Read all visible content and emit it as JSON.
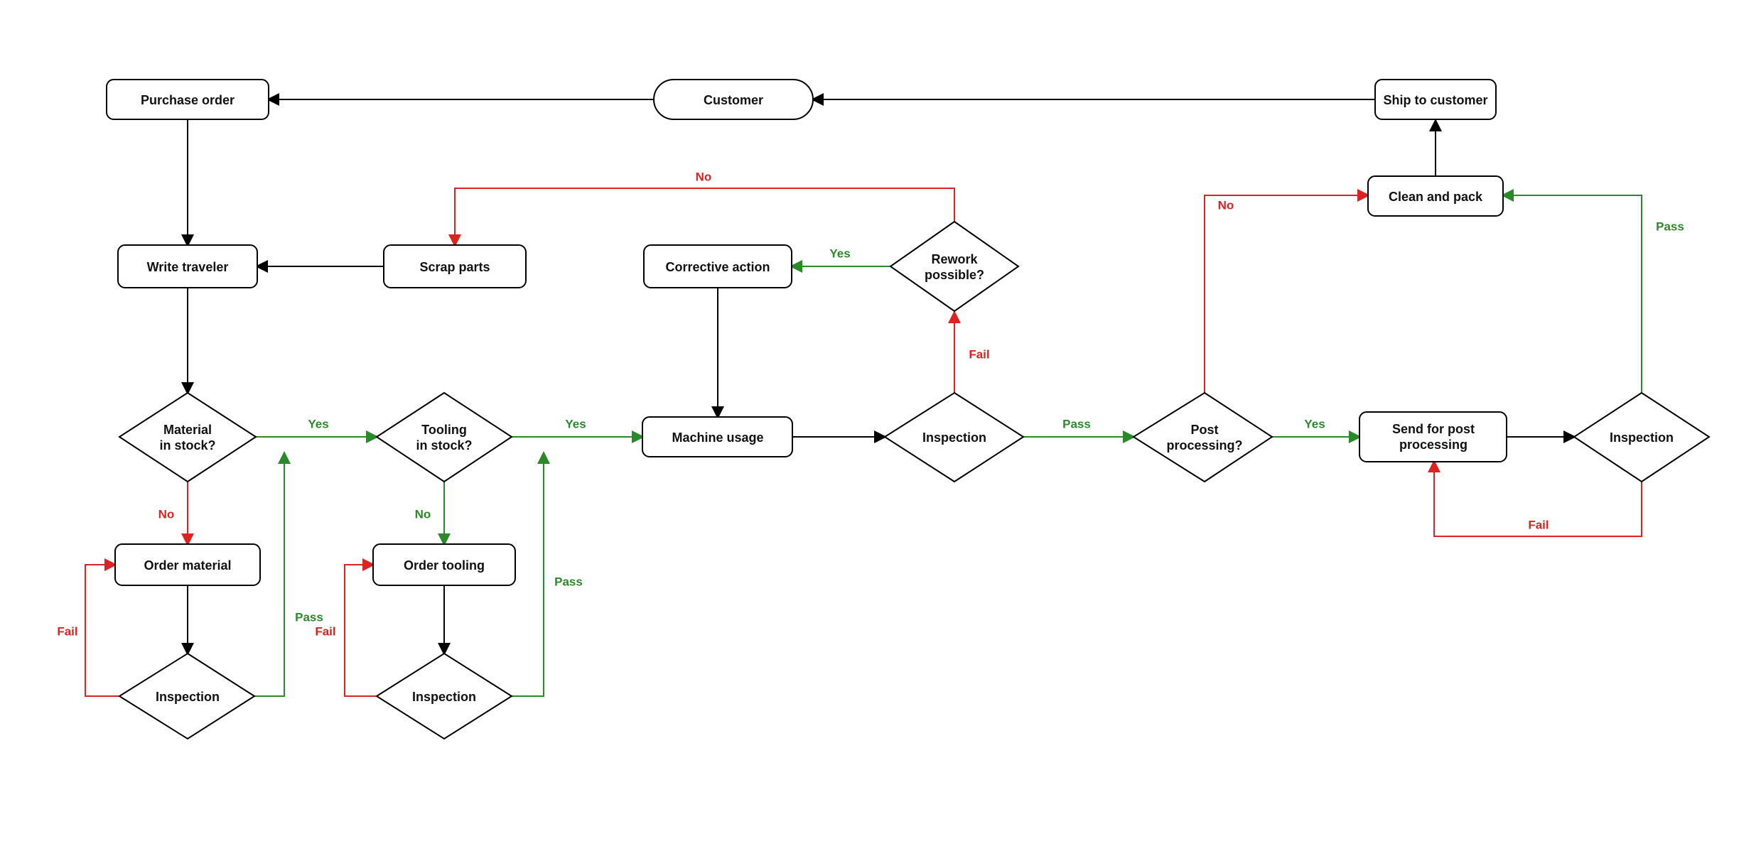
{
  "nodes": {
    "purchase_order": {
      "label": "Purchase order"
    },
    "customer": {
      "label": "Customer"
    },
    "ship_to_customer": {
      "label": "Ship to customer"
    },
    "write_traveler": {
      "label": "Write traveler"
    },
    "scrap_parts": {
      "label": "Scrap parts"
    },
    "corrective_action": {
      "label": "Corrective action"
    },
    "rework_possible": {
      "line1": "Rework",
      "line2": "possible?"
    },
    "clean_and_pack": {
      "label": "Clean and pack"
    },
    "material_in_stock": {
      "line1": "Material",
      "line2": "in stock?"
    },
    "tooling_in_stock": {
      "line1": "Tooling",
      "line2": "in stock?"
    },
    "machine_usage": {
      "label": "Machine usage"
    },
    "inspection1": {
      "label": "Inspection"
    },
    "post_processing": {
      "line1": "Post",
      "line2": "processing?"
    },
    "send_post_proc": {
      "line1": "Send for post",
      "line2": "processing"
    },
    "inspection2": {
      "label": "Inspection"
    },
    "order_material": {
      "label": "Order material"
    },
    "order_tooling": {
      "label": "Order tooling"
    },
    "inspection_mat": {
      "label": "Inspection"
    },
    "inspection_tool": {
      "label": "Inspection"
    }
  },
  "labels": {
    "yes": "Yes",
    "no": "No",
    "pass": "Pass",
    "fail": "Fail"
  }
}
